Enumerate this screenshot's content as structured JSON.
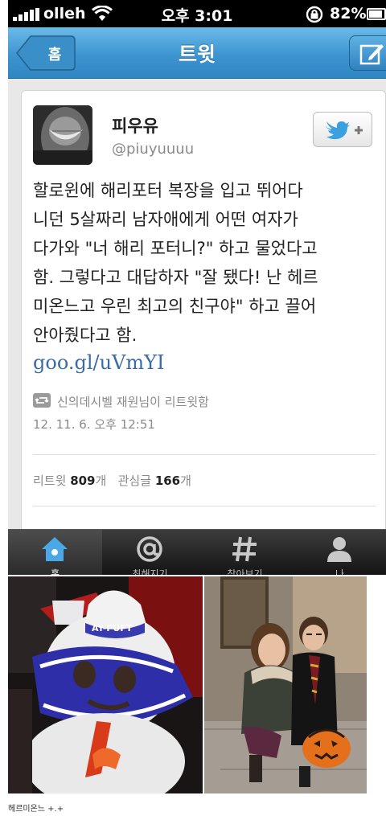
{
  "status_bar": {
    "carrier": "olleh",
    "time": "오후 3:01",
    "battery": "82%"
  },
  "nav": {
    "back_label": "홈",
    "title": "트윗"
  },
  "tweet": {
    "display_name": "피우유",
    "screen_name": "@piuyuuuu",
    "text_lines": [
      "할로윈에 해리포터 복장을 입고 뛰어다",
      "니던 5살짜리 남자애에게 어떤 여자가",
      "다가와 \"너 해리 포터니?\" 하고 물었다고",
      "함. 그렇다고 대답하자 \"잘 됐다! 난 헤르",
      "미온느고 우린 최고의 친구야\" 하고 끌어",
      "안아줬다고 함."
    ],
    "link": "goo.gl/uVmYI",
    "retweeted_by": "신의데시벨 재원님이 리트윗함",
    "timestamp": "12. 11. 6. 오후 12:51",
    "stats": {
      "retweets_label": "리트윗",
      "retweets_count": "809",
      "retweets_unit": "개",
      "favorites_label": "관심글",
      "favorites_count": "166",
      "favorites_unit": "개"
    }
  },
  "tab_bar": {
    "tabs": [
      {
        "label": "홈",
        "icon": "home-icon",
        "active": true
      },
      {
        "label": "최해지기",
        "icon": "at-icon",
        "active": false
      },
      {
        "label": "찾아보기",
        "icon": "hash-icon",
        "active": false
      },
      {
        "label": "나",
        "icon": "person-icon",
        "active": false
      }
    ]
  },
  "photos": {
    "left_badge": "AY-PUFT"
  },
  "caption": "헤르미온느 +.+",
  "colors": {
    "nav_blue": "#3d94cf",
    "link_blue": "#3a6aa8",
    "twitter_bird": "#3aa0e0"
  }
}
